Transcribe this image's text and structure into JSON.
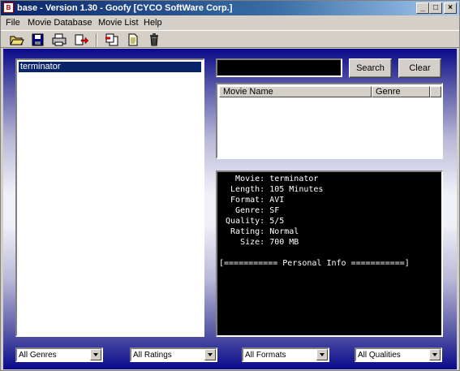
{
  "window": {
    "title": "base - Version 1.30 - Goofy [CYCO SoftWare Corp.]",
    "controls": {
      "minimize": "_",
      "maximize": "□",
      "close": "×"
    }
  },
  "menu": [
    "File",
    "Movie Database",
    "Movie List",
    "Help"
  ],
  "toolbar": {
    "icons": [
      "open-folder-icon",
      "save-icon",
      "print-icon",
      "export-icon",
      "delete-copy-icon",
      "new-document-icon",
      "trash-icon"
    ]
  },
  "movie_list": {
    "items": [
      "terminator"
    ],
    "selected": 0
  },
  "search": {
    "value": "",
    "button_label": "Search",
    "clear_label": "Clear"
  },
  "results": {
    "columns": [
      "Movie Name",
      "Genre"
    ],
    "rows": []
  },
  "info": {
    "lines": [
      "   Movie: terminator",
      "  Length: 105 Minutes",
      "  Format: AVI",
      "   Genre: SF",
      " Quality: 5/5",
      "  Rating: Normal",
      "    Size: 700 MB",
      "",
      "[=========== Personal Info ===========]"
    ]
  },
  "filters": {
    "genres": "All Genres",
    "ratings": "All Ratings",
    "formats": "All Formats",
    "qualities": "All Qualities"
  },
  "colors": {
    "title_bar": "#0a246a",
    "selection": "#0a246a",
    "info_panel": "#000000",
    "background_gradient_edge": "#0a0a8c"
  }
}
